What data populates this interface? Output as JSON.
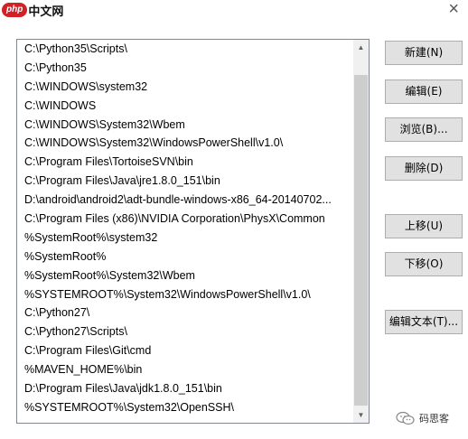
{
  "watermark_logo": {
    "brand": "php",
    "text": "中文网"
  },
  "title_close": "×",
  "paths": [
    "C:\\Python35\\Scripts\\",
    "C:\\Python35",
    "C:\\WINDOWS\\system32",
    "C:\\WINDOWS",
    "C:\\WINDOWS\\System32\\Wbem",
    "C:\\WINDOWS\\System32\\WindowsPowerShell\\v1.0\\",
    "C:\\Program Files\\TortoiseSVN\\bin",
    "C:\\Program Files\\Java\\jre1.8.0_151\\bin",
    "D:\\android\\android2\\adt-bundle-windows-x86_64-20140702...",
    "C:\\Program Files (x86)\\NVIDIA Corporation\\PhysX\\Common",
    "%SystemRoot%\\system32",
    "%SystemRoot%",
    "%SystemRoot%\\System32\\Wbem",
    "%SYSTEMROOT%\\System32\\WindowsPowerShell\\v1.0\\",
    "C:\\Python27\\",
    "C:\\Python27\\Scripts\\",
    "C:\\Program Files\\Git\\cmd",
    "%MAVEN_HOME%\\bin",
    "D:\\Program Files\\Java\\jdk1.8.0_151\\bin",
    "%SYSTEMROOT%\\System32\\OpenSSH\\"
  ],
  "buttons": {
    "new": "新建(N)",
    "edit": "编辑(E)",
    "browse": "浏览(B)...",
    "delete": "删除(D)",
    "move_up": "上移(U)",
    "move_down": "下移(O)",
    "edit_text": "编辑文本(T)..."
  },
  "scroll": {
    "up": "▲",
    "down": "▼"
  },
  "footer_watermark": "码思客",
  "icon_names": {
    "wechat": "wechat-icon"
  }
}
